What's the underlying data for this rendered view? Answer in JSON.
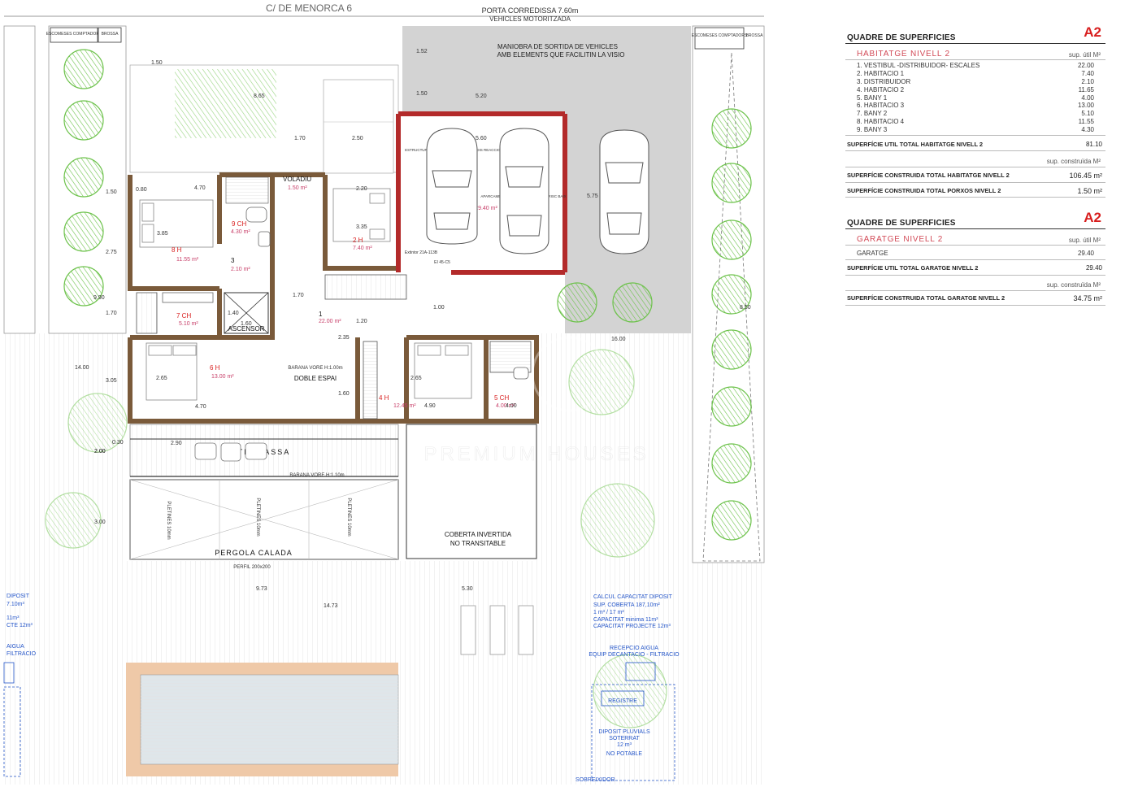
{
  "plan": {
    "street": "C/ DE MENORCA 6",
    "gate_line1": "PORTA CORREDISSA 7.60m",
    "gate_line2": "VEHICLES MOTORITZADA",
    "maneuver_line1": "MANIOBRA DE SORTIDA DE VEHICLES",
    "maneuver_line2": "AMB ELEMENTS QUE FACILITIN LA VISIO",
    "meters_left": "ESCOMESES COMPTADORS",
    "trash_left": "BROSSA",
    "meters_right": "ESCOMESES COMPTADORS",
    "trash_right": "BROSSA",
    "voladiu_label": "VOLADIU",
    "voladiu_area": "1.50 m²",
    "ascensor": "ASCENSOR",
    "doble_espai": "DOBLE ESPAI",
    "barana_vore": "BARANA VORE H:1.00m",
    "terrassa": "TERRASSA",
    "barana_terrassa": "BARANA VORE H:1.10m",
    "pergola": "PERGOLA CALADA",
    "perfil": "PERFIL 200x200",
    "pletines1": "PLETINES 10mm",
    "pletines2": "PLETINES 10mm",
    "pletines3": "PLETINES 10mm",
    "coberta_line1": "COBERTA INVERTIDA",
    "coberta_line2": "NO TRANSITABLE",
    "garage_area": "29.40 m²",
    "estructura_note": "ESTRUCTURA ELEMENT CONTRA INCENDIS REACCIO MATERIALS",
    "aparcament_note": "APARCAMENT LOCAL RISC ESPECIAL RISC BAIX",
    "extintor": "Extintor 21A-113B",
    "bie": "EI 45-C5",
    "rooms": [
      {
        "num": "1",
        "area": "22.00 m²"
      },
      {
        "num": "2 H",
        "area": "7.40 m²"
      },
      {
        "num": "3",
        "area": "2.10 m²"
      },
      {
        "num": "4 H",
        "area": "12.45 m²"
      },
      {
        "num": "5 CH",
        "area": "4.00 m²"
      },
      {
        "num": "6 H",
        "area": "13.00 m²"
      },
      {
        "num": "7 CH",
        "area": "5.10 m²"
      },
      {
        "num": "8 H",
        "area": "11.55 m²"
      },
      {
        "num": "9 CH",
        "area": "4.30 m²"
      }
    ],
    "dims": [
      "1.50",
      "8.65",
      "1.70",
      "2.50",
      "5.60",
      "5.75",
      "4.70",
      "3.85",
      "2.20",
      "3.35",
      "0.80",
      "1.50",
      "2.75",
      "1.70",
      "1.70",
      "1.40",
      "1.60",
      "1.00",
      "1.20",
      "2.35",
      "2.65",
      "4.70",
      "3.05",
      "2.65",
      "4.90",
      "1.60",
      "2.90",
      "4.00",
      "0.30",
      "9.73",
      "14.73",
      "5.30",
      "16.00",
      "14.00",
      "3.00",
      "2.00",
      "9.90",
      "1.52",
      "1.50",
      "5.20",
      "8.50",
      "2.00"
    ],
    "tank_left_1": "DIPOSIT",
    "tank_left_2": "7.10m³",
    "tank_left_3": "11m³",
    "tank_left_4": "CTE 12m³",
    "tank_left_5": "AIGUA",
    "tank_left_6": "FILTRACIO",
    "calc_title": "CALCUL CAPACITAT DIPOSIT",
    "calc_1": "SUP. COBERTA  187,10m²",
    "calc_2": "1 m³ / 17 m²",
    "calc_3": "CAPACITAT minima 11m³",
    "calc_4": "CAPACITAT PROJECTE  12m³",
    "recepcio_1": "RECEPCIO AIGUA",
    "recepcio_2": "EQUIP DECANTACIO - FILTRACIO",
    "registre": "REGISTRE",
    "diposit_1": "DIPOSIT PLUVIALS",
    "diposit_2": "SOTERRAT",
    "diposit_3": "12 m³",
    "diposit_4": "NO POTABLE",
    "sobreixidor": "SOBREIXIDOR",
    "watermark": "PREMIUM HOUSES"
  },
  "table_habitatge": {
    "title": "QUADRE DE SUPERFICIES",
    "code": "A2",
    "section": "HABITATGE  NIVELL 2",
    "unit_util": "sup. útil M²",
    "items": [
      {
        "label": "1. VESTIBUL -DISTRIBUIDOR- ESCALES",
        "value": "22.00"
      },
      {
        "label": "2. HABITACIO 1",
        "value": "7.40"
      },
      {
        "label": "3. DISTRIBUIDOR",
        "value": "2.10"
      },
      {
        "label": "4. HABITACIO 2",
        "value": "11.65"
      },
      {
        "label": "5. BANY 1",
        "value": "4.00"
      },
      {
        "label": "6. HABITACIO 3",
        "value": "13.00"
      },
      {
        "label": "7. BANY 2",
        "value": "5.10"
      },
      {
        "label": "8. HABITACIO 4",
        "value": "11.55"
      },
      {
        "label": "9. BANY 3",
        "value": "4.30"
      }
    ],
    "total_util_label": "SUPERFÍCIE UTIL TOTAL HABITATGE NIVELL 2",
    "total_util_value": "81.10",
    "unit_construida": "sup. construïda M²",
    "total_const_label": "SUPERFÍCIE CONSTRUIDA TOTAL HABITATGE NIVELL 2",
    "total_const_value": "106.45 m²",
    "total_porxos_label": "SUPERFÍCIE CONSTRUIDA TOTAL PORXOS NIVELL 2",
    "total_porxos_value": "1.50 m²"
  },
  "table_garatge": {
    "title": "QUADRE DE SUPERFICIES",
    "code": "A2",
    "section": "GARATGE  NIVELL 2",
    "unit_util": "sup. útil M²",
    "items": [
      {
        "label": "GARATGE",
        "value": "29.40"
      }
    ],
    "total_util_label": "SUPERFÍCIE UTIL TOTAL GARATGE NIVELL 2",
    "total_util_value": "29.40",
    "unit_construida": "sup. construïda M²",
    "total_const_label": "SUPERFÍCIE CONSTRUIDA TOTAL GARATGE NIVELL 2",
    "total_const_value": "34.75 m²"
  },
  "colors": {
    "wall": "#7a5a3a",
    "fire_wall": "#b32a2a",
    "paving": "#d3d3d3",
    "tree": "#6cc24a",
    "pool_edge": "#efc9a8",
    "pool_water": "#dfe6ea",
    "blue_text": "#2455c8",
    "red_text": "#d81e1e",
    "pink_text": "#c8406a"
  }
}
